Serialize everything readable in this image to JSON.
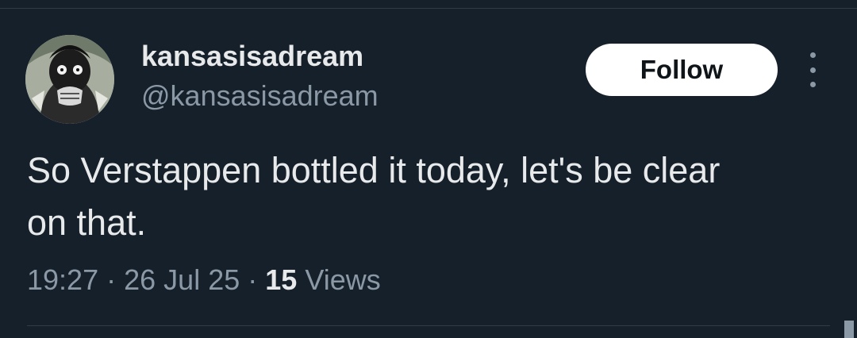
{
  "user": {
    "display_name": "kansasisadream",
    "handle": "@kansasisadream"
  },
  "actions": {
    "follow_label": "Follow",
    "more_icon": "more-vertical-icon"
  },
  "tweet": {
    "text": "So Verstappen bottled it today, let's be clear\non that.",
    "time": "19:27",
    "separator": "·",
    "date": "26 Jul 25",
    "views_count": "15",
    "views_label": "Views"
  },
  "colors": {
    "background": "#15202b",
    "primary_text": "#e7e9ea",
    "secondary_text": "#8b98a5",
    "follow_bg": "#ffffff",
    "divider": "#2f3b47"
  }
}
